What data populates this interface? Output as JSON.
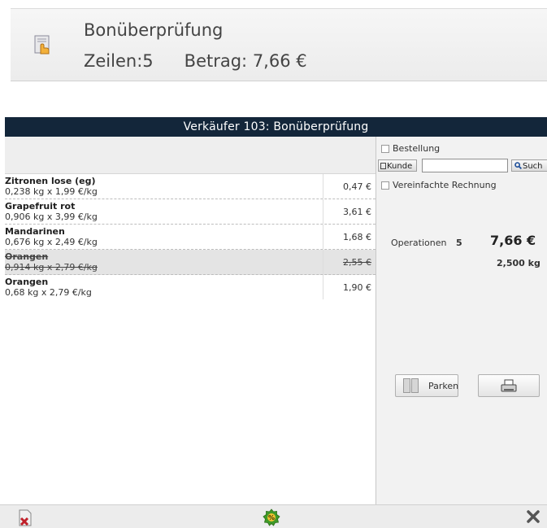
{
  "banner": {
    "title": "Bonüberprüfung",
    "lines_label": "Zeilen:",
    "lines_value": "5",
    "amount_label": "Betrag:",
    "amount_value": "7,66 €",
    "icon": "receipt-hand-icon"
  },
  "window": {
    "title": "Verkäufer 103: Bonüberprüfung"
  },
  "items": [
    {
      "name": "Zitronen lose (eg)",
      "detail": "0,238 kg x 1,99 €/kg",
      "price": "0,47 €",
      "cancelled": false
    },
    {
      "name": "Grapefruit rot",
      "detail": "0,906 kg x 3,99 €/kg",
      "price": "3,61 €",
      "cancelled": false
    },
    {
      "name": "Mandarinen",
      "detail": "0,676 kg x 2,49 €/kg",
      "price": "1,68 €",
      "cancelled": false
    },
    {
      "name": "Orangen",
      "detail": "0,914 kg x 2,79 €/kg",
      "price": "2,55 €",
      "cancelled": true
    },
    {
      "name": "Orangen",
      "detail": "0,68 kg x 2,79 €/kg",
      "price": "1,90 €",
      "cancelled": false
    }
  ],
  "sidebar": {
    "order_label": "Bestellung",
    "customer_button": "Kunde",
    "customer_input_value": "",
    "search_button": "Such",
    "simplified_invoice_label": "Vereinfachte Rechnung",
    "operations_label": "Operationen",
    "operations_count": "5",
    "total": "7,66 €",
    "weight": "2,500 kg",
    "park_button": "Parken"
  },
  "icons": {
    "delete": "delete-receipt-icon",
    "discount": "discount-badge-icon",
    "close": "close-icon",
    "print": "printer-icon",
    "park": "park-icon",
    "search": "search-icon"
  },
  "colors": {
    "titlebar": "#13263a",
    "cancelled_row": "#e4e4e4",
    "discount_green": "#3f9a28",
    "delete_red": "#c0202a"
  }
}
